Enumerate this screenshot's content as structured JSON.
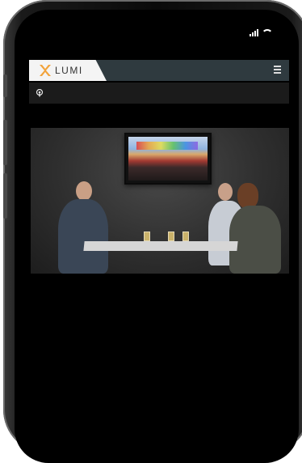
{
  "app": {
    "brand_name": "LUMI",
    "brand_color": "#f2a33a",
    "header_color": "#2f3a3f"
  },
  "status_bar": {
    "signal_icon": "signal-bars-icon",
    "wifi_icon": "wifi-icon"
  },
  "header": {
    "menu_icon": "hamburger-menu-icon"
  },
  "subbar": {
    "icon": "podcast-icon"
  },
  "video": {
    "description_icon": "video-stream"
  }
}
